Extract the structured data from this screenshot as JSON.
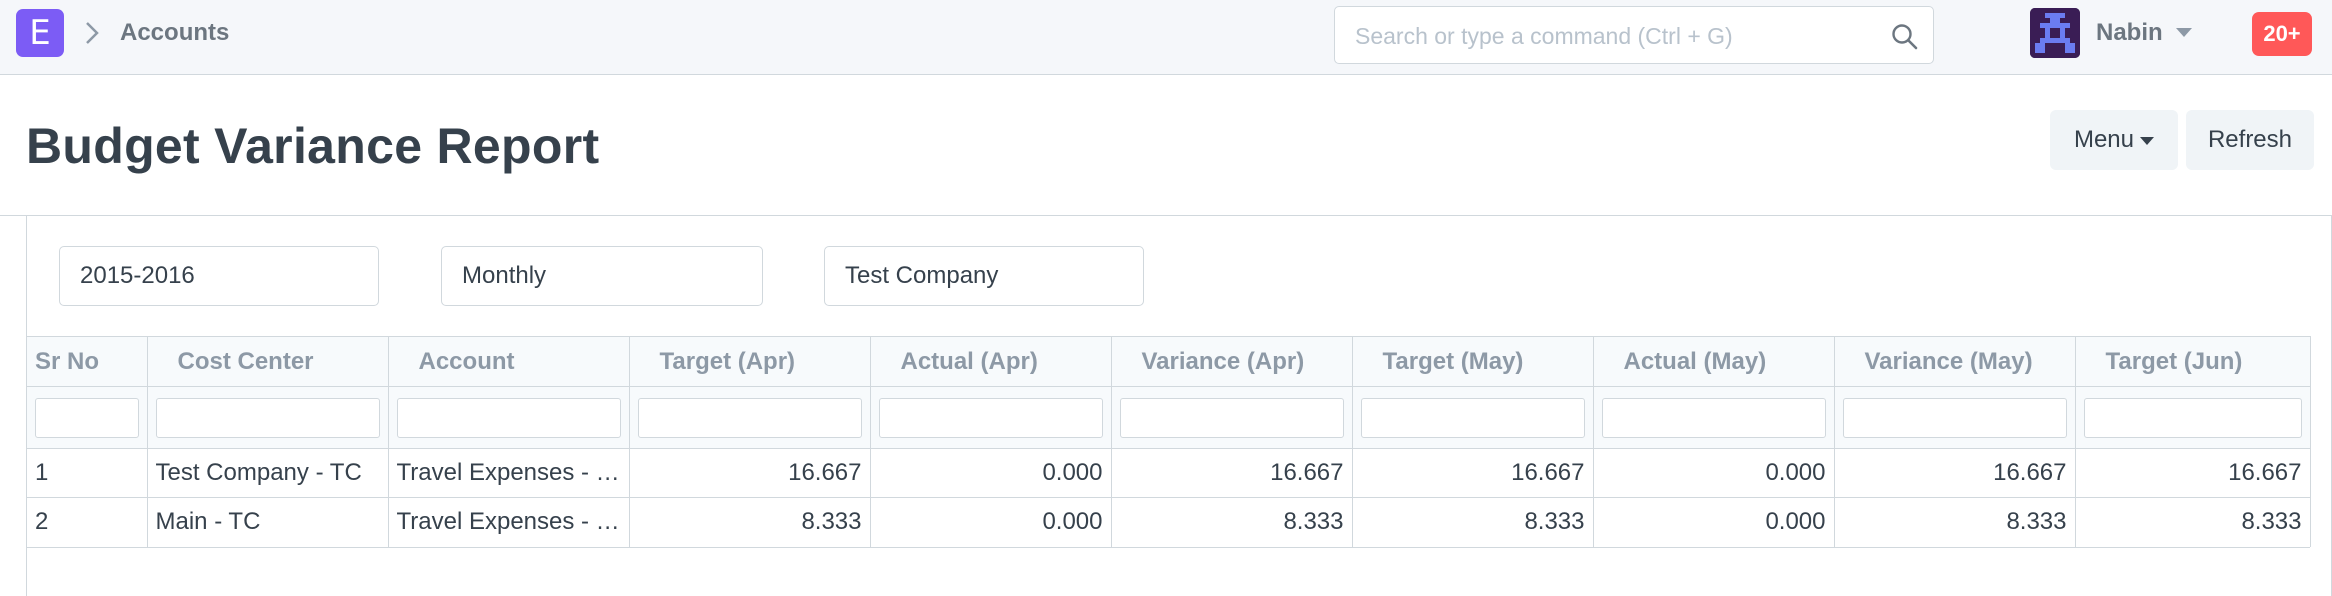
{
  "navbar": {
    "brand_letter": "E",
    "breadcrumb": "Accounts",
    "search_placeholder": "Search or type a command (Ctrl + G)",
    "user_name": "Nabin",
    "notifications": "20+"
  },
  "page": {
    "title": "Budget Variance Report",
    "menu_label": "Menu",
    "refresh_label": "Refresh"
  },
  "filters": {
    "fiscal_year": "2015-2016",
    "period": "Monthly",
    "company": "Test Company"
  },
  "table": {
    "columns": [
      "Sr No",
      "Cost Center",
      "Account",
      "Target (Apr)",
      "Actual (Apr)",
      "Variance (Apr)",
      "Target (May)",
      "Actual (May)",
      "Variance (May)",
      "Target (Jun)"
    ],
    "rows": [
      [
        "1",
        "Test Company - TC",
        "Travel Expenses - …",
        "16.667",
        "0.000",
        "16.667",
        "16.667",
        "0.000",
        "16.667",
        "16.667"
      ],
      [
        "2",
        "Main - TC",
        "Travel Expenses - …",
        "8.333",
        "0.000",
        "8.333",
        "8.333",
        "0.000",
        "8.333",
        "8.333"
      ]
    ]
  },
  "colors": {
    "brand": "#7c5cf5",
    "notification": "#ff5858",
    "border": "#d1d8dd",
    "header_bg": "#f5f7fa"
  }
}
